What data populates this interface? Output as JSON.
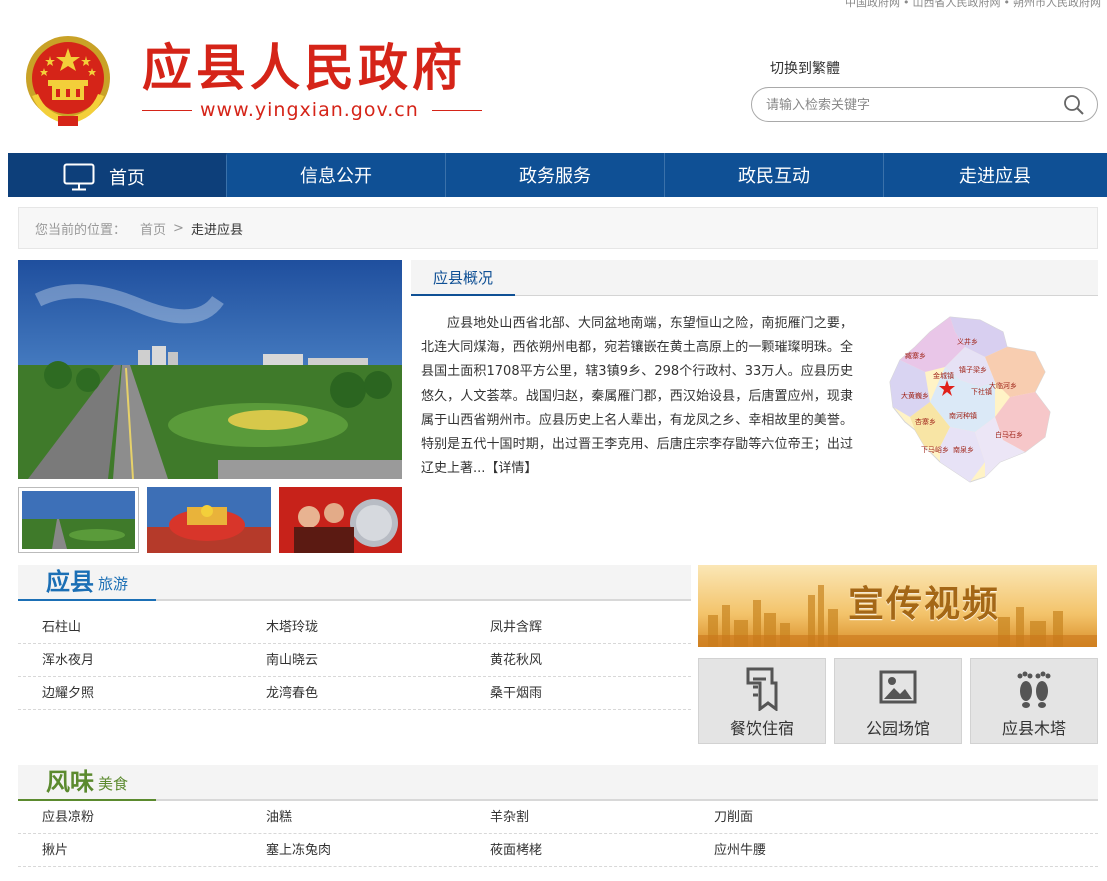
{
  "top_links": [
    "中国政府网",
    "山西省人民政府网",
    "朔州市人民政府网"
  ],
  "header": {
    "title": "应县人民政府",
    "url": "www.yingxian.gov.cn",
    "traditional_toggle": "切换到繁體",
    "search_placeholder": "请输入检索关键字"
  },
  "nav": {
    "home": "首页",
    "items": [
      "信息公开",
      "政务服务",
      "政民互动",
      "走进应县"
    ]
  },
  "breadcrumb": {
    "label": "您当前的位置：",
    "home": "首页",
    "separator": ">",
    "current": "走进应县"
  },
  "overview": {
    "title": "应县概况",
    "text": "应县地处山西省北部、大同盆地南端，东望恒山之险，南扼雁门之要，北连大同煤海，西依朔州电都，宛若镶嵌在黄土高原上的一颗璀璨明珠。全县国土面积1708平方公里，辖3镇9乡、298个行政村、33万人。应县历史悠久，人文荟萃。战国归赵，秦属雁门郡，西汉始设县，后唐置应州，现隶属于山西省朔州市。应县历史上名人辈出，有龙凤之乡、幸相故里的美誉。特别是五代十国时期，出过晋王李克用、后唐庄宗李存勖等六位帝王；出过辽史上著...",
    "more": "【详情】",
    "map_labels": [
      "义井乡",
      "臧寨乡",
      "金城镇",
      "镇子梁乡",
      "大临河乡",
      "大黄巍乡",
      "下社镇",
      "南河种镇",
      "杏寨乡",
      "白马石乡",
      "下马峪乡",
      "南泉乡"
    ]
  },
  "travel": {
    "title_big": "应县",
    "title_small": "旅游",
    "rows": [
      [
        "石柱山",
        "木塔玲珑",
        "凤井含辉"
      ],
      [
        "浑水夜月",
        "南山晓云",
        "黄花秋风"
      ],
      [
        "边耀夕照",
        "龙湾春色",
        "桑干烟雨"
      ]
    ]
  },
  "video": {
    "banner": "宣传视频",
    "tiles": [
      {
        "label": "餐饮住宿",
        "icon": "bookmark-doc-icon"
      },
      {
        "label": "公园场馆",
        "icon": "picture-icon"
      },
      {
        "label": "应县木塔",
        "icon": "footprints-icon"
      }
    ]
  },
  "food": {
    "title_big": "风味",
    "title_small": "美食",
    "rows": [
      [
        "应县凉粉",
        "油糕",
        "羊杂割",
        "刀削面"
      ],
      [
        "揪片",
        "塞上冻兔肉",
        "莜面栲栳",
        "应州牛腰"
      ]
    ]
  },
  "colors": {
    "nav": "#0f5095",
    "nav_home": "#0d3f7a",
    "title_red": "#d52418",
    "travel_blue": "#1b6fb5",
    "food_green": "#5b8a2e"
  }
}
